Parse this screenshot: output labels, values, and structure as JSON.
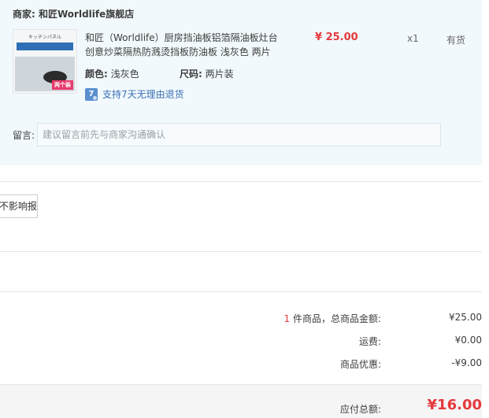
{
  "shop": {
    "label": "商家:",
    "name": "和匠Worldlife旗舰店"
  },
  "product": {
    "thumb_top": "キッチンパネル",
    "thumb_line": "耐高温铝箔 隔热防溅油",
    "thumb_tag": "两个装",
    "title": "和匠（Worldlife）厨房挡油板铝箔隔油板灶台创意炒菜隔热防溅烫挡板防油板 浅灰色 两片",
    "price": "¥ 25.00",
    "quantity": "x1",
    "stock": "有货",
    "color_label": "颜色:",
    "color_value": "浅灰色",
    "size_label": "尺码:",
    "size_value": "两片装",
    "service": "支持7天无理由退货",
    "service_icon": "7"
  },
  "message": {
    "label": "留言:",
    "placeholder": "建议留言前先与商家沟通确认"
  },
  "invoice": {
    "button_label": "不影响报销"
  },
  "summary": {
    "count": "1",
    "goods_label": "件商品，总商品金额:",
    "goods_value": "¥25.00",
    "shipping_label": "运费:",
    "shipping_value": "¥0.00",
    "discount_label": "商品优惠:",
    "discount_value": "-¥9.00",
    "total_label": "应付总额:",
    "total_value": "¥16.00"
  },
  "colors": {
    "accent_red": "#e4393c",
    "panel_bg": "#f2f9fd",
    "link_blue": "#3a6fb3"
  }
}
